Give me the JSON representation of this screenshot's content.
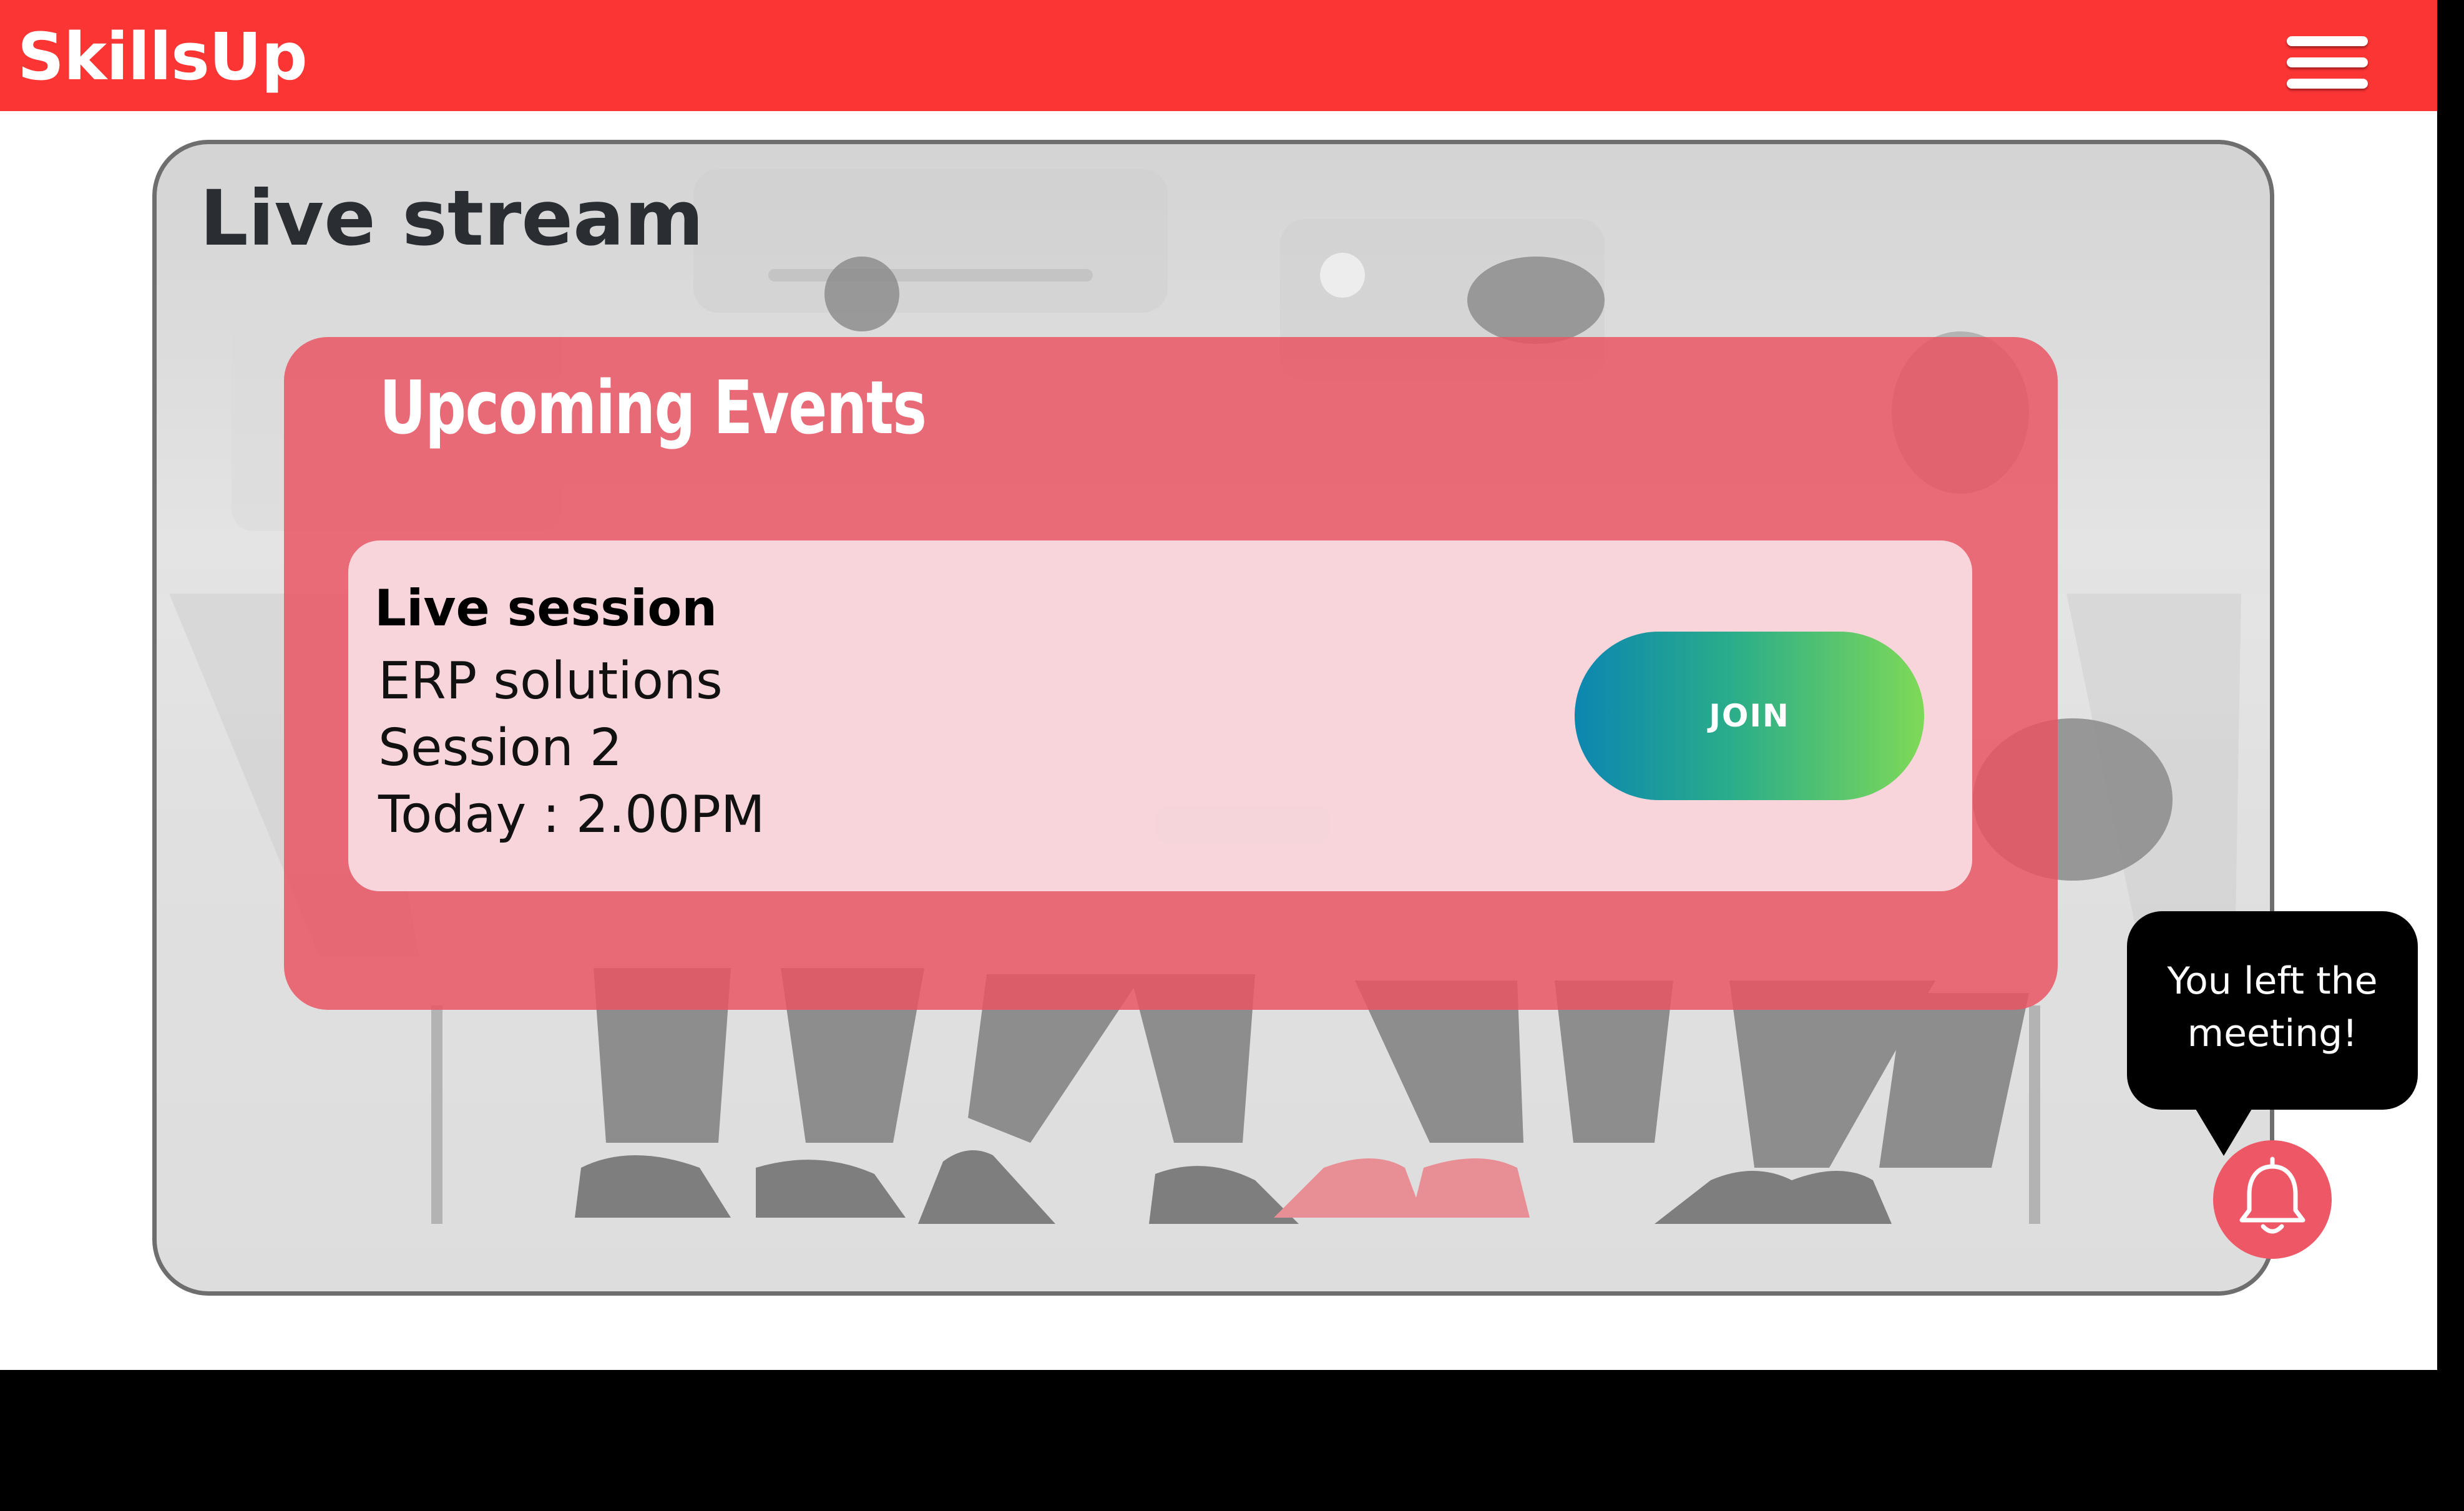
{
  "header": {
    "brand": "SkillsUp",
    "menu_icon": "hamburger-menu-icon",
    "background_color": "#fb3434"
  },
  "live_stream": {
    "title": "Live stream"
  },
  "upcoming_events": {
    "title": "Upcoming Events",
    "events": [
      {
        "type": "Live session",
        "name": "ERP solutions",
        "session": "Session 2",
        "time": "Today : 2.00PM",
        "action_label": "JOIN"
      }
    ]
  },
  "notification": {
    "message_line1": "You left the",
    "message_line2": "meeting!",
    "icon": "bell-icon"
  },
  "colors": {
    "accent": "#fb3434",
    "panel": "#ea5462",
    "join_gradient_start": "#0c86b0",
    "join_gradient_end": "#7ed957"
  }
}
